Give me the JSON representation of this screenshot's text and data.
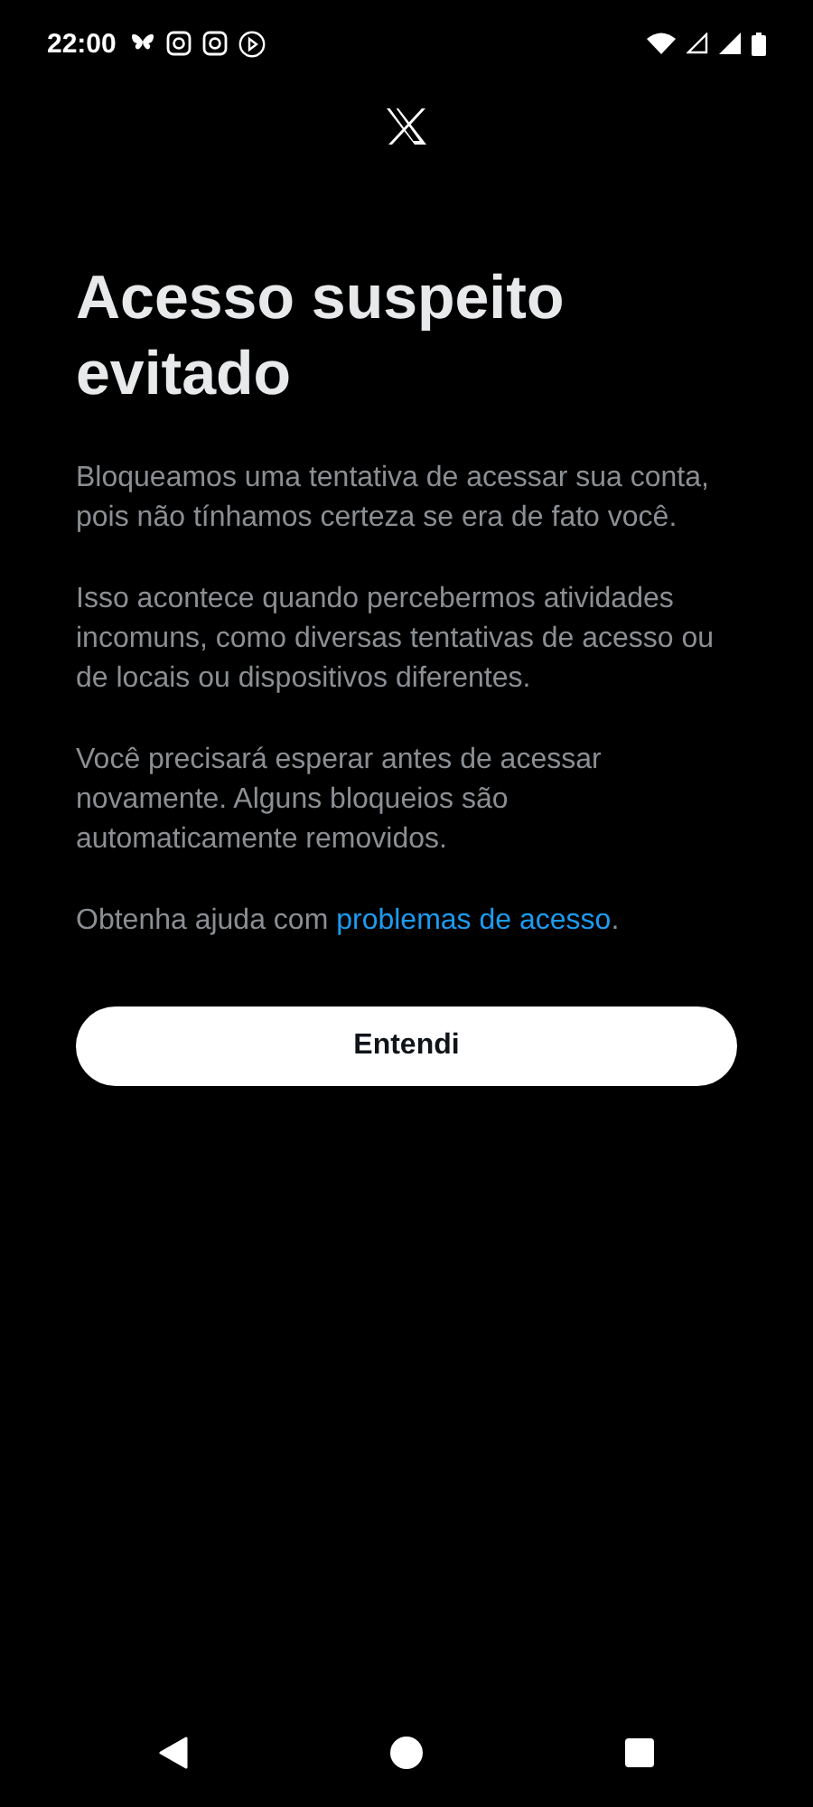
{
  "status_bar": {
    "time": "22:00"
  },
  "title": "Acesso suspeito evitado",
  "paragraphs": [
    "Bloqueamos uma tentativa de acessar sua conta, pois não tínhamos certeza se era de fato você.",
    "Isso acontece quando percebermos atividades incomuns, como diversas tentativas de acesso ou de locais ou dispositivos diferentes.",
    "Você precisará esperar antes de acessar novamente. Alguns bloqueios são automaticamente removidos."
  ],
  "help": {
    "text": "Obtenha ajuda com ",
    "link": "problemas de acesso",
    "suffix": "."
  },
  "button": "Entendi"
}
